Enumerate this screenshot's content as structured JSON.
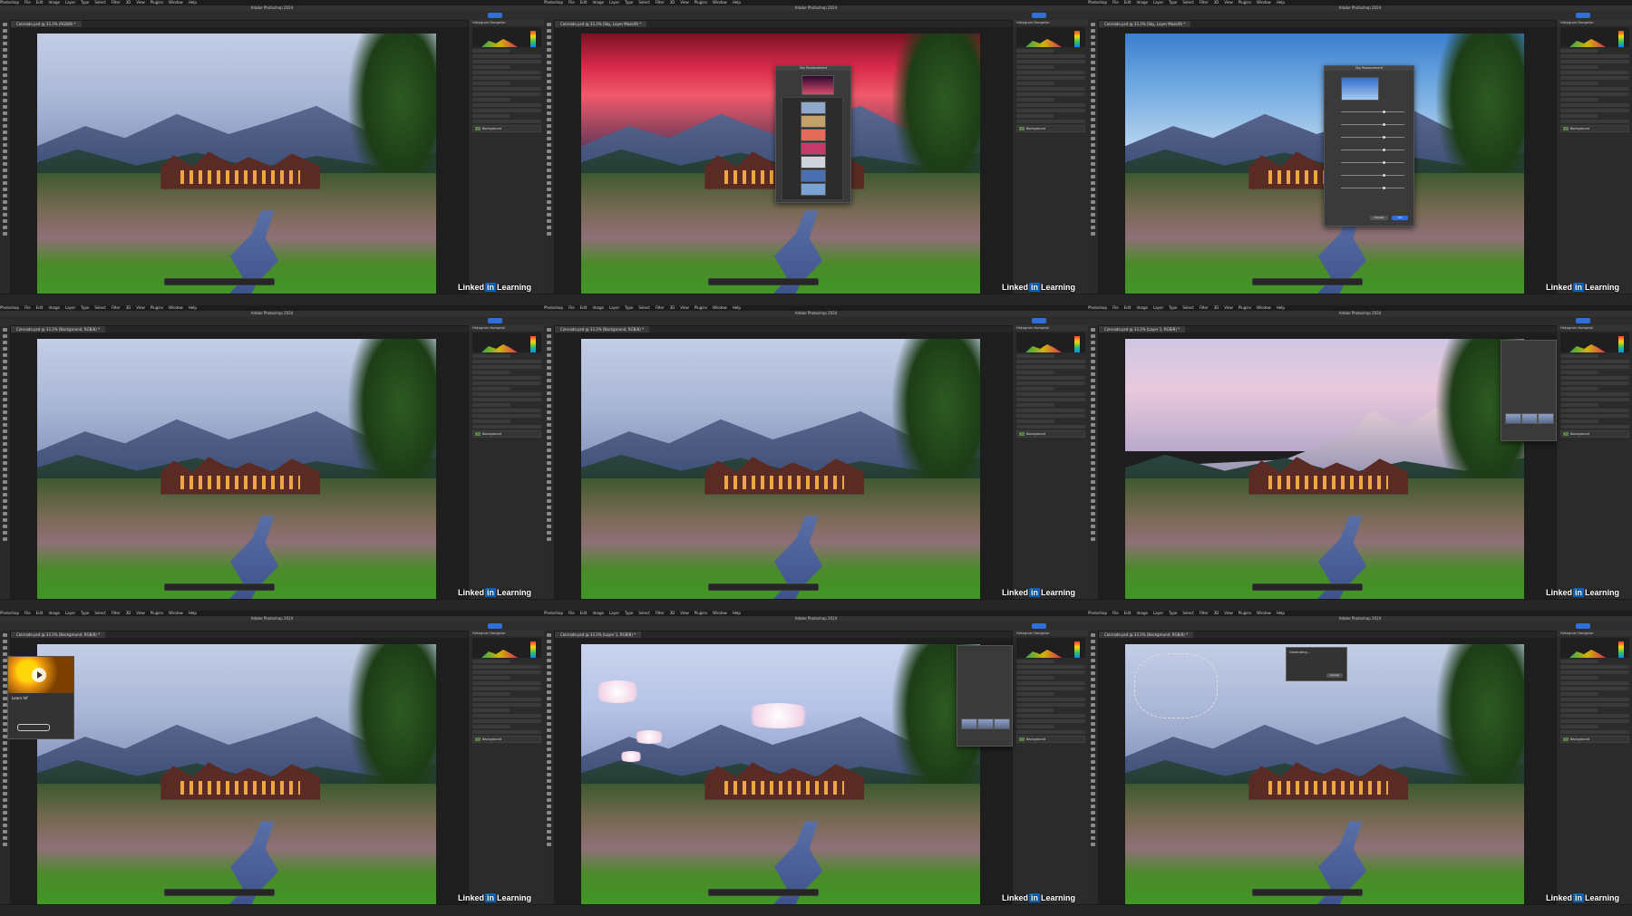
{
  "app": {
    "menus": [
      "Photoshop",
      "File",
      "Edit",
      "Image",
      "Layer",
      "Type",
      "Select",
      "Filter",
      "3D",
      "View",
      "Plugins",
      "Window",
      "Help"
    ],
    "title": "Adobe Photoshop 2024",
    "share_label": "Share",
    "watermark_brand": "Linked",
    "watermark_in": "in",
    "watermark_product": "Learning",
    "layer_background": "Background",
    "panel_tabs": "Histogram  Navigator"
  },
  "tiles": [
    {
      "sky": "day",
      "doc_tab": "Colorado.psd @ 33.3% (RGB/8) *",
      "dialog": null
    },
    {
      "sky": "sunset",
      "doc_tab": "Colorado.psd @ 33.3% (Sky, Layer Mask/8) *",
      "dialog": "sky-picker"
    },
    {
      "sky": "blue",
      "doc_tab": "Colorado.psd @ 33.3% (Sky, Layer Mask/8) *",
      "dialog": "sky-replacement"
    },
    {
      "sky": "day",
      "doc_tab": "Colorado.psd @ 33.3% (Background, RGB/8) *",
      "dialog": null
    },
    {
      "sky": "day",
      "doc_tab": "Colorado.psd @ 33.3% (Background, RGB/8) *",
      "dialog": null
    },
    {
      "sky": "pink",
      "doc_tab": "Colorado.psd @ 33.3% (Layer 1, RGB/8) *",
      "dialog": "properties"
    },
    {
      "sky": "day",
      "doc_tab": "Colorado.psd @ 33.3% (Background, RGB/8) *",
      "dialog": "learn"
    },
    {
      "sky": "clouds",
      "doc_tab": "Colorado.psd @ 33.3% (Layer 1, RGB/8) *",
      "dialog": "properties"
    },
    {
      "sky": "day",
      "doc_tab": "Colorado.psd @ 33.3% (Background, RGB/8) *",
      "dialog": "generating"
    }
  ],
  "dialogs": {
    "sky_replacement_title": "Sky Replacement",
    "ok_label": "OK",
    "cancel_label": "Cancel",
    "generating_title": "Generating...",
    "learn_title": "Learn Inf"
  },
  "colors": {
    "accent": "#2f6fdc",
    "linkedin": "#0a66c2"
  }
}
